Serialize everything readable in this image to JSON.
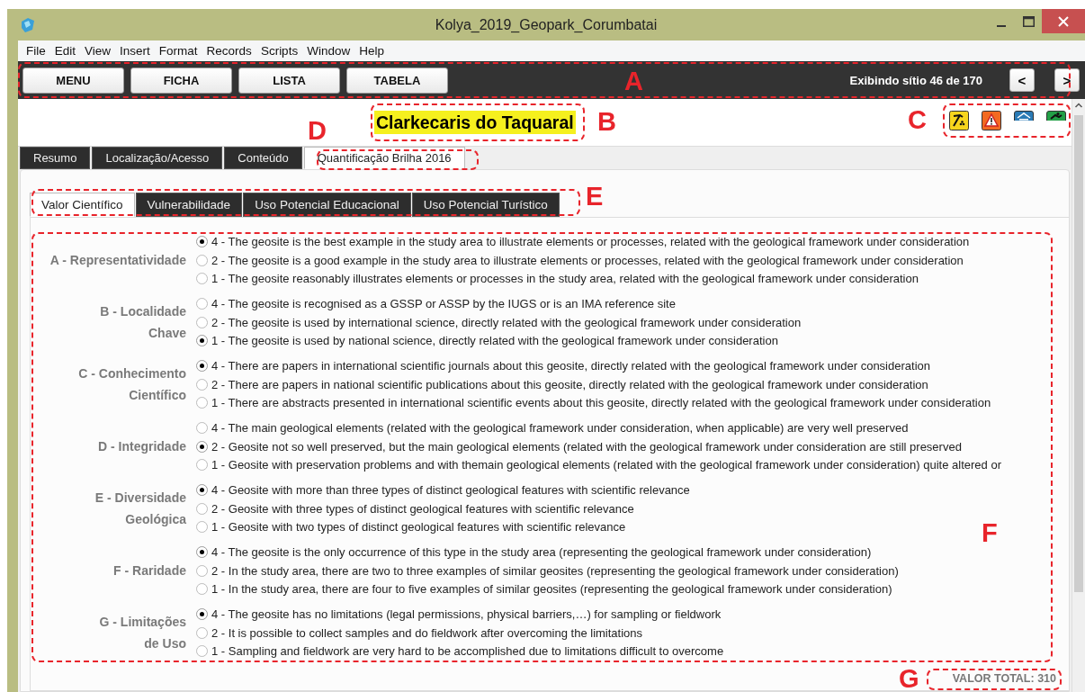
{
  "window": {
    "title": "Kolya_2019_Geopark_Corumbatai"
  },
  "menu": [
    "File",
    "Edit",
    "View",
    "Insert",
    "Format",
    "Records",
    "Scripts",
    "Window",
    "Help"
  ],
  "toolbar": {
    "buttons": [
      "MENU",
      "FICHA",
      "LISTA",
      "TABELA"
    ],
    "record_status": "Exibindo sítio 46 de 170",
    "nav_buttons": [
      "<",
      ">"
    ]
  },
  "site_title": "Clarkecaris do Taquaral",
  "site_icons": [
    {
      "kind": "hammer",
      "color": "#f7d51d"
    },
    {
      "kind": "warning",
      "color": "#f26a22"
    },
    {
      "kind": "shelter",
      "color": "#2a7ab5"
    },
    {
      "kind": "activity",
      "color": "#23a047"
    }
  ],
  "tabs": [
    {
      "label": "Resumo",
      "selected": false
    },
    {
      "label": "Localização/Acesso",
      "selected": false
    },
    {
      "label": "Conteúdo",
      "selected": false
    },
    {
      "label": "Quantificação Brilha 2016",
      "selected": true
    }
  ],
  "subtabs": [
    {
      "label": "Valor Científico",
      "selected": true
    },
    {
      "label": "Vulnerabilidade",
      "selected": false
    },
    {
      "label": "Uso Potencial Educacional",
      "selected": false
    },
    {
      "label": "Uso Potencial Turístico",
      "selected": false
    }
  ],
  "criteria": [
    {
      "label": "A - Representatividade",
      "options": [
        {
          "text": "4 - The geosite is the best example in the study area to illustrate elements or processes, related with the geological framework under consideration",
          "selected": true
        },
        {
          "text": "2 - The geosite is a good example in the study area to illustrate elements or processes, related with the geological framework under consideration",
          "selected": false
        },
        {
          "text": "1 - The geosite reasonably illustrates elements or processes in the study area, related with the geological framework under consideration",
          "selected": false
        }
      ]
    },
    {
      "label": "B - Localidade\nChave",
      "options": [
        {
          "text": "4 - The geosite is recognised as a GSSP or ASSP by the IUGS or is an IMA reference site",
          "selected": false
        },
        {
          "text": "2 - The geosite is used by international science, directly related with the geological framework under consideration",
          "selected": false
        },
        {
          "text": "1 - The geosite is used by national science, directly related with the geological framework under consideration",
          "selected": true
        }
      ]
    },
    {
      "label": "C - Conhecimento\nCientífico",
      "options": [
        {
          "text": "4 - There are papers in international scientific journals about this geosite, directly related with the geological framework under consideration",
          "selected": true
        },
        {
          "text": "2 - There are papers in national scientific publications about this geosite, directly related with the geological framework under consideration",
          "selected": false
        },
        {
          "text": "1 - There are abstracts presented in international scientific events about this geosite, directly related with the geological framework under consideration",
          "selected": false
        }
      ]
    },
    {
      "label": "D - Integridade",
      "options": [
        {
          "text": "4 - The main geological elements (related with the geological framework under consideration, when applicable) are very well preserved",
          "selected": false
        },
        {
          "text": "2 - Geosite not so well preserved, but the main geological elements (related with the geological framework under consideration are still preserved",
          "selected": true
        },
        {
          "text": "1 - Geosite with preservation problems and with themain geological elements (related with the geological framework under consideration) quite altered or",
          "selected": false
        }
      ]
    },
    {
      "label": "E - Diversidade\nGeológica",
      "options": [
        {
          "text": "4 - Geosite with more than three types of distinct geological features with scientific relevance",
          "selected": true
        },
        {
          "text": "2 - Geosite with three types of distinct geological features with scientific relevance",
          "selected": false
        },
        {
          "text": "1 - Geosite with two types of distinct geological features with scientific relevance",
          "selected": false
        }
      ]
    },
    {
      "label": "F - Raridade",
      "options": [
        {
          "text": "4 - The geosite is the only occurrence of this type in the study area (representing the geological framework under consideration)",
          "selected": true
        },
        {
          "text": "2 - In the study area, there are two to three examples of similar geosites (representing the geological framework under consideration)",
          "selected": false
        },
        {
          "text": "1 - In the study area, there are four to five examples of similar geosites (representing the geological framework under consideration)",
          "selected": false
        }
      ]
    },
    {
      "label": "G - Limitações\nde Uso",
      "options": [
        {
          "text": "4 - The geosite has no limitations (legal permissions, physical barriers,…) for sampling or fieldwork",
          "selected": true
        },
        {
          "text": "2 - It is possible to collect samples and do fieldwork after overcoming the limitations",
          "selected": false
        },
        {
          "text": "1 - Sampling and fieldwork are very hard to be accomplished due to limitations difficult to overcome",
          "selected": false
        }
      ]
    }
  ],
  "total": "VALOR TOTAL: 310",
  "annotations": [
    {
      "label": "A"
    },
    {
      "label": "B"
    },
    {
      "label": "C"
    },
    {
      "label": "D"
    },
    {
      "label": "E"
    },
    {
      "label": "F"
    },
    {
      "label": "G"
    }
  ]
}
